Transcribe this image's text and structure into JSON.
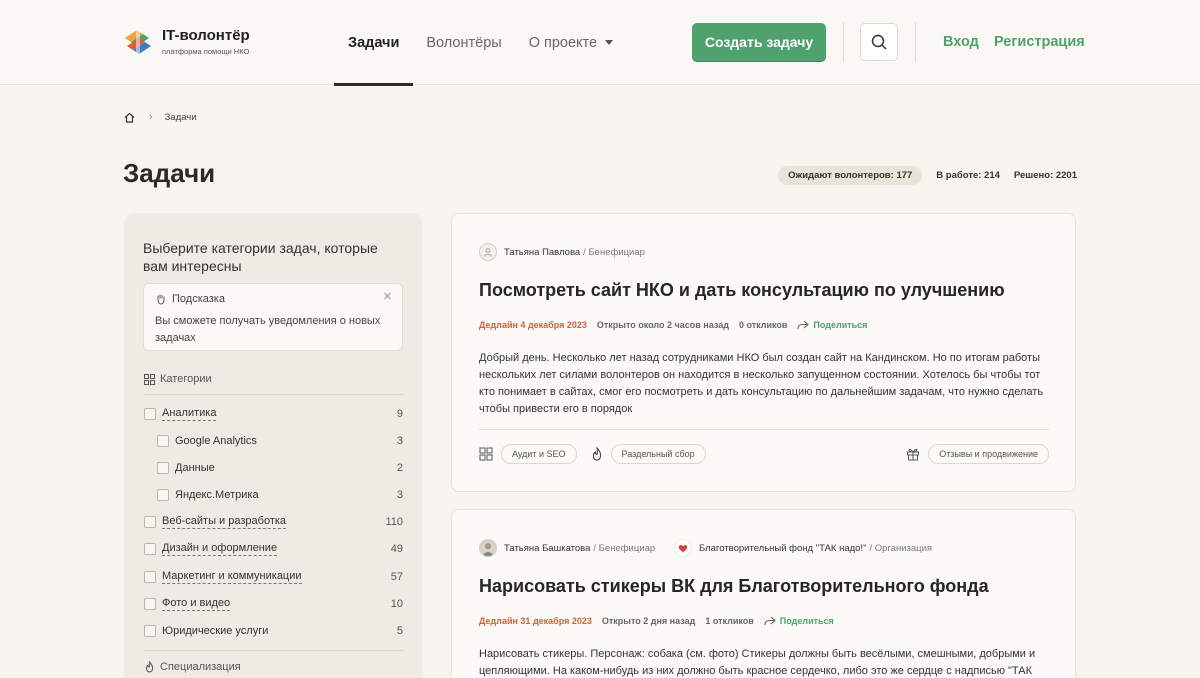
{
  "header": {
    "logo_title": "IT-волонтёр",
    "logo_subtitle": "платформа помощи НКО",
    "nav": [
      {
        "label": "Задачи",
        "active": true
      },
      {
        "label": "Волонтёры",
        "active": false
      },
      {
        "label": "О проекте",
        "active": false
      }
    ],
    "create_button": "Создать задачу",
    "login": "Вход",
    "register": "Регистрация",
    "accent_color": "#4fa16e"
  },
  "breadcrumb": {
    "current": "Задачи"
  },
  "page_title": "Задачи",
  "stats": {
    "waiting": "Ожидают волонтеров: 177",
    "in_progress": "В работе: 214",
    "solved": "Решено: 2201"
  },
  "sidebar": {
    "heading": "Выберите категории задач, которые вам интересны",
    "hint_title": "Подсказка",
    "hint_text": "Вы сможете получать уведомления о новых задачах",
    "categories_title": "Категории",
    "specialization_title": "Специализация",
    "categories": [
      {
        "label": "Аналитика",
        "count": "9"
      },
      {
        "label": "Google Analytics",
        "count": "3"
      },
      {
        "label": "Данные",
        "count": "2"
      },
      {
        "label": "Яндекс.Метрика",
        "count": "3"
      },
      {
        "label": "Веб-сайты и разработка",
        "count": "110"
      },
      {
        "label": "Дизайн и оформление",
        "count": "49"
      },
      {
        "label": "Маркетинг и коммуникации",
        "count": "57"
      },
      {
        "label": "Фото и видео",
        "count": "10"
      },
      {
        "label": "Юридические услуги",
        "count": "5"
      }
    ]
  },
  "tasks": [
    {
      "author": "Татьяна Павлова",
      "author_role": "/ Бенефициар",
      "title": "Посмотреть сайт НКО и дать консультацию по улучшению",
      "deadline": "Дедлайн 4 декабря 2023",
      "opened": "Открыто около 2 часов назад",
      "responses": "0 откликов",
      "share": "Поделиться",
      "text": "Добрый день. Несколько лет назад сотрудниками НКО был создан сайт на Кандинском. Но по итогам работы нескольких лет силами волонтеров он находится в несколько запущенном состоянии. Хотелось бы чтобы тот кто понимает в сайтах, смог его посмотреть и дать консультацию по дальнейшим задачам, что нужно сделать чтобы привести его в порядок",
      "tag1": "Аудит и SEO",
      "tag2": "Раздельный сбор",
      "tag3": "Отзывы и продвижение"
    },
    {
      "author": "Татьяна Башкатова",
      "author_role": "/ Бенефициар",
      "org": "Благотворительный фонд \"ТАК надо!\"",
      "org_role": "/ Организация",
      "title": "Нарисовать стикеры ВК для Благотворительного фонда",
      "deadline": "Дедлайн 31 декабря 2023",
      "opened": "Открыто 2 дня назад",
      "responses": "1 откликов",
      "share": "Поделиться",
      "text": "Нарисовать стикеры. Персонаж: собака (см. фото) Стикеры должны быть весёлыми, смешными, добрыми и цепляющими. На каком-нибудь из них должно быть красное сердечко, либо это же сердце с надписью \"ТАК"
    }
  ]
}
